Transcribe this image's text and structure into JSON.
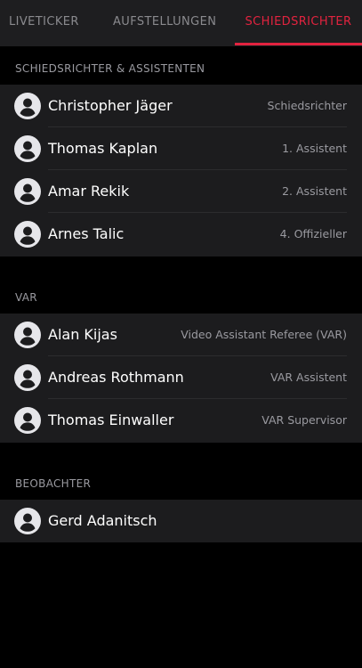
{
  "tabs": [
    {
      "label": "LIVETICKER",
      "active": false
    },
    {
      "label": "AUFSTELLUNGEN",
      "active": false
    },
    {
      "label": "SCHIEDSRICHTER",
      "active": true
    }
  ],
  "accent_color": "#e2233f",
  "sections": [
    {
      "title": "SCHIEDSRICHTER & ASSISTENTEN",
      "people": [
        {
          "name": "Christopher Jäger",
          "role": "Schiedsrichter",
          "icon": "person-avatar-icon"
        },
        {
          "name": "Thomas Kaplan",
          "role": "1. Assistent",
          "icon": "person-avatar-icon"
        },
        {
          "name": "Amar Rekik",
          "role": "2. Assistent",
          "icon": "person-avatar-icon"
        },
        {
          "name": "Arnes Talic",
          "role": "4. Offizieller",
          "icon": "person-avatar-icon"
        }
      ]
    },
    {
      "title": "VAR",
      "people": [
        {
          "name": "Alan Kijas",
          "role": "Video Assistant Referee (VAR)",
          "icon": "person-avatar-icon"
        },
        {
          "name": "Andreas Rothmann",
          "role": "VAR Assistent",
          "icon": "person-avatar-icon"
        },
        {
          "name": "Thomas Einwaller",
          "role": "VAR Supervisor",
          "icon": "person-avatar-icon"
        }
      ]
    },
    {
      "title": "BEOBACHTER",
      "people": [
        {
          "name": "Gerd Adanitsch",
          "role": "",
          "icon": "person-avatar-icon"
        }
      ]
    }
  ]
}
